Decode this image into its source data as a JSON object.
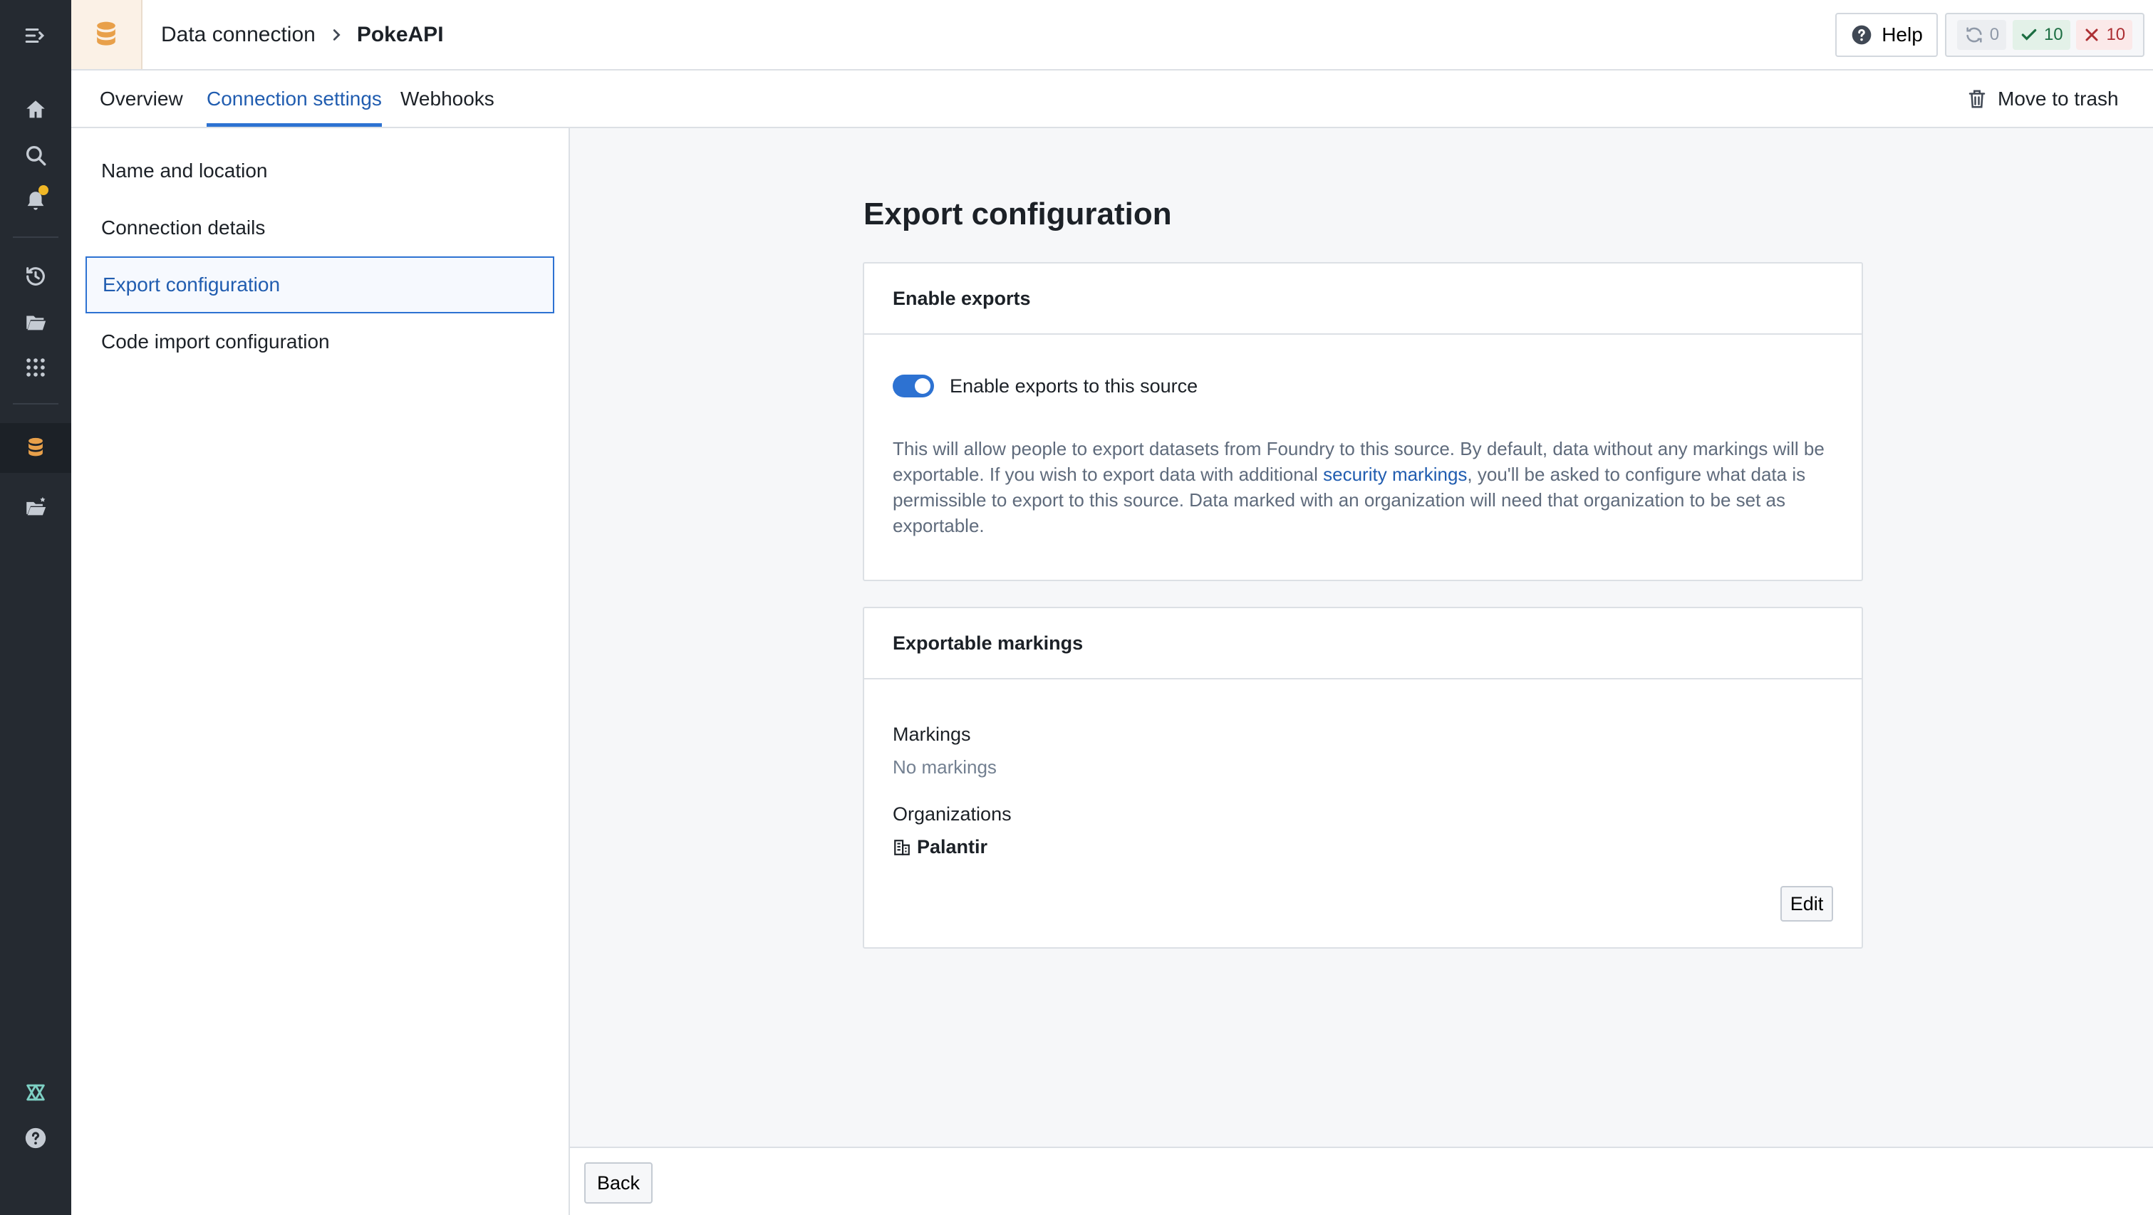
{
  "header": {
    "breadcrumb_root": "Data connection",
    "breadcrumb_current": "PokeAPI",
    "help_label": "Help",
    "status": {
      "syncing": "0",
      "succeeded": "10",
      "failed": "10"
    }
  },
  "tabs": [
    {
      "label": "Overview"
    },
    {
      "label": "Connection settings"
    },
    {
      "label": "Webhooks"
    }
  ],
  "move_to_trash_label": "Move to trash",
  "settings_nav": [
    {
      "label": "Name and location"
    },
    {
      "label": "Connection details"
    },
    {
      "label": "Export configuration"
    },
    {
      "label": "Code import configuration"
    }
  ],
  "main": {
    "title": "Export configuration",
    "enable_card": {
      "heading": "Enable exports",
      "toggle_label": "Enable exports to this source",
      "desc_part1": "This will allow people to export datasets from Foundry to this source. By default, data without any markings will be exportable. If you wish to export data with additional ",
      "desc_link": "security markings",
      "desc_part2": ", you'll be asked to configure what data is permissible to export to this source. Data marked with an organization will need that organization to be set as exportable."
    },
    "markings_card": {
      "heading": "Exportable markings",
      "markings_label": "Markings",
      "markings_value": "No markings",
      "orgs_label": "Organizations",
      "org_name": "Palantir",
      "edit_label": "Edit"
    }
  },
  "footer": {
    "back_label": "Back"
  },
  "colors": {
    "accent": "#2d72d2",
    "rail": "#252a31",
    "app_icon": "#e8a04a"
  }
}
